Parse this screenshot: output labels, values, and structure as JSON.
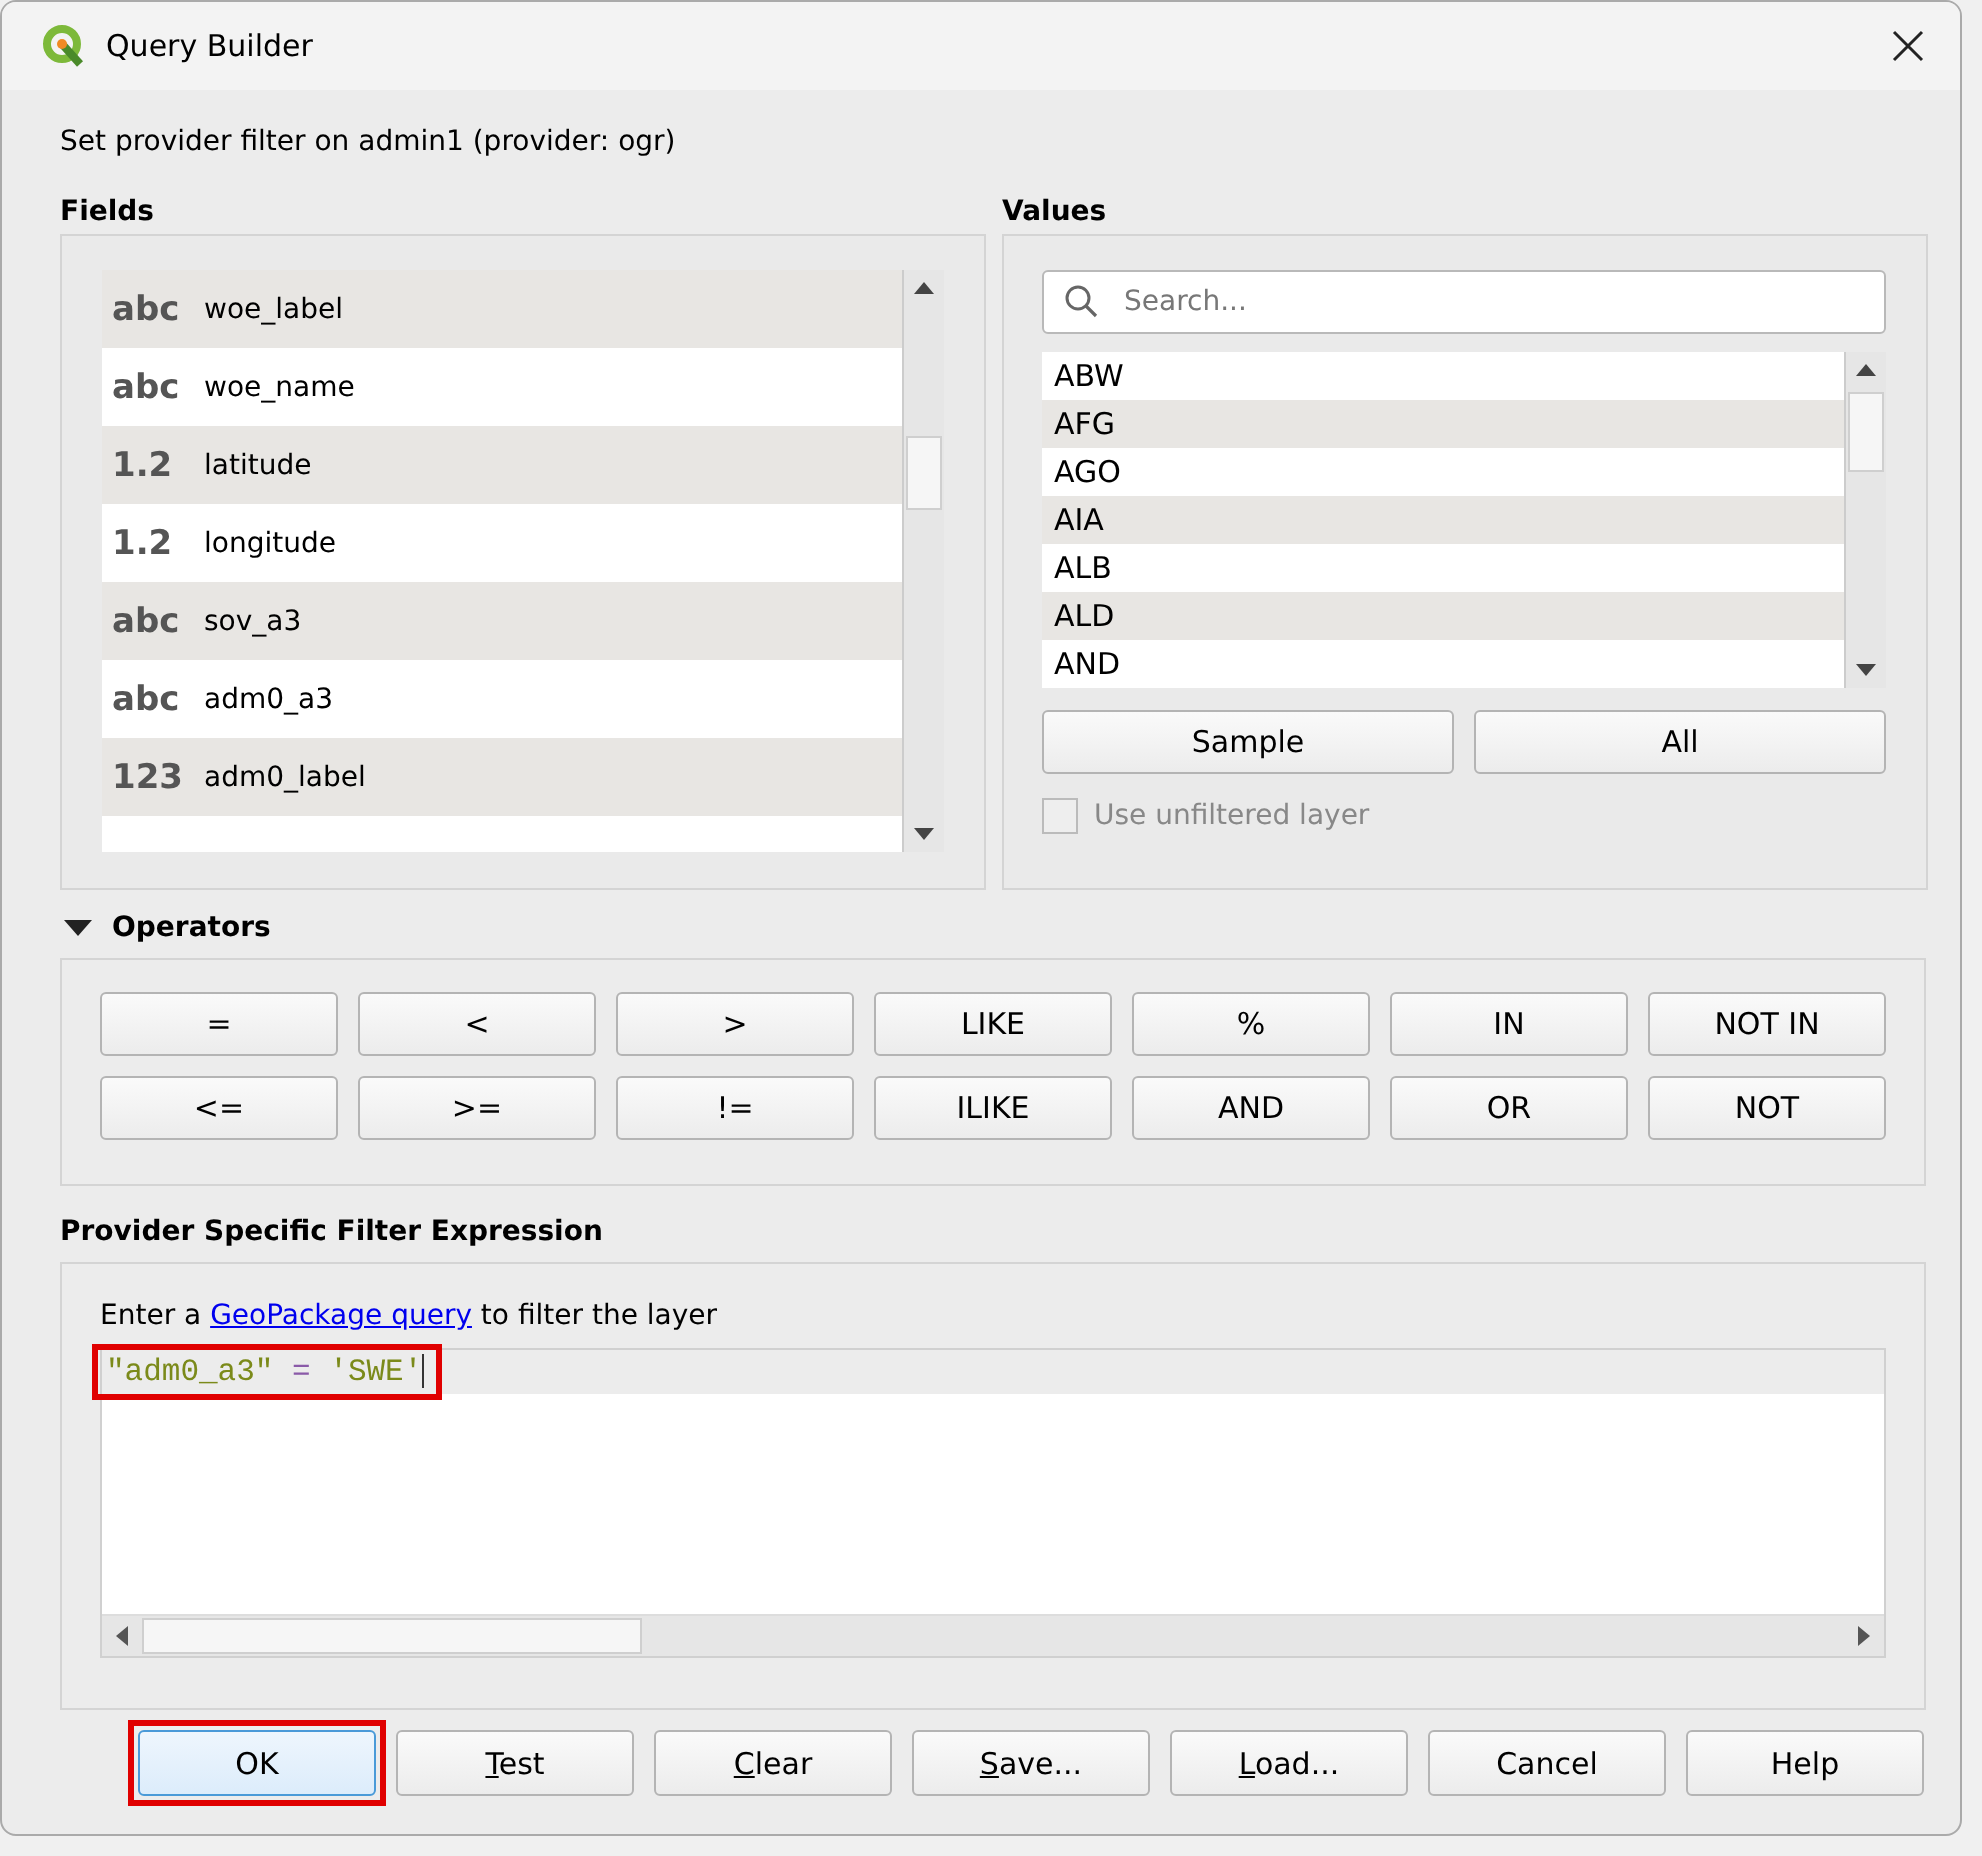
{
  "window": {
    "title": "Query Builder"
  },
  "subtitle": "Set provider filter on admin1 (provider: ogr)",
  "fields": {
    "title": "Fields",
    "items": [
      {
        "type": "abc",
        "name": "woe_label"
      },
      {
        "type": "abc",
        "name": "woe_name"
      },
      {
        "type": "1.2",
        "name": "latitude"
      },
      {
        "type": "1.2",
        "name": "longitude"
      },
      {
        "type": "abc",
        "name": "sov_a3"
      },
      {
        "type": "abc",
        "name": "adm0_a3"
      },
      {
        "type": "123",
        "name": "adm0_label"
      }
    ]
  },
  "values": {
    "title": "Values",
    "search": {
      "placeholder": "Search..."
    },
    "items": [
      "ABW",
      "AFG",
      "AGO",
      "AIA",
      "ALB",
      "ALD",
      "AND"
    ],
    "buttons": [
      "Sample",
      "All"
    ],
    "use_unfiltered": {
      "label": "Use unfiltered layer",
      "checked": false,
      "disabled": true
    }
  },
  "operators": {
    "title": "Operators",
    "expanded": true,
    "buttons": [
      "=",
      "<",
      ">",
      "LIKE",
      "%",
      "IN",
      "NOT IN",
      "<=",
      ">=",
      "!=",
      "ILIKE",
      "AND",
      "OR",
      "NOT"
    ]
  },
  "expression": {
    "title": "Provider Specific Filter Expression",
    "hint_before": "Enter a ",
    "hint_link": "GeoPackage query",
    "hint_after": " to filter the layer",
    "highlighted": true,
    "tokens": [
      {
        "kind": "field",
        "text": "\"adm0_a3\""
      },
      {
        "kind": "operator",
        "text": "="
      },
      {
        "kind": "string",
        "text": "'SWE'"
      }
    ]
  },
  "buttons": [
    {
      "label": "OK",
      "default": true,
      "highlighted": true
    },
    {
      "mnemonic": "T",
      "label": "est",
      "default": false,
      "highlighted": false
    },
    {
      "mnemonic": "C",
      "label": "lear",
      "default": false,
      "highlighted": false
    },
    {
      "mnemonic": "S",
      "label": "ave...",
      "default": false,
      "highlighted": false
    },
    {
      "mnemonic": "L",
      "label": "oad...",
      "default": false,
      "highlighted": false
    },
    {
      "label": "Cancel",
      "default": false,
      "highlighted": false
    },
    {
      "label": "Help",
      "default": false,
      "highlighted": false
    }
  ]
}
